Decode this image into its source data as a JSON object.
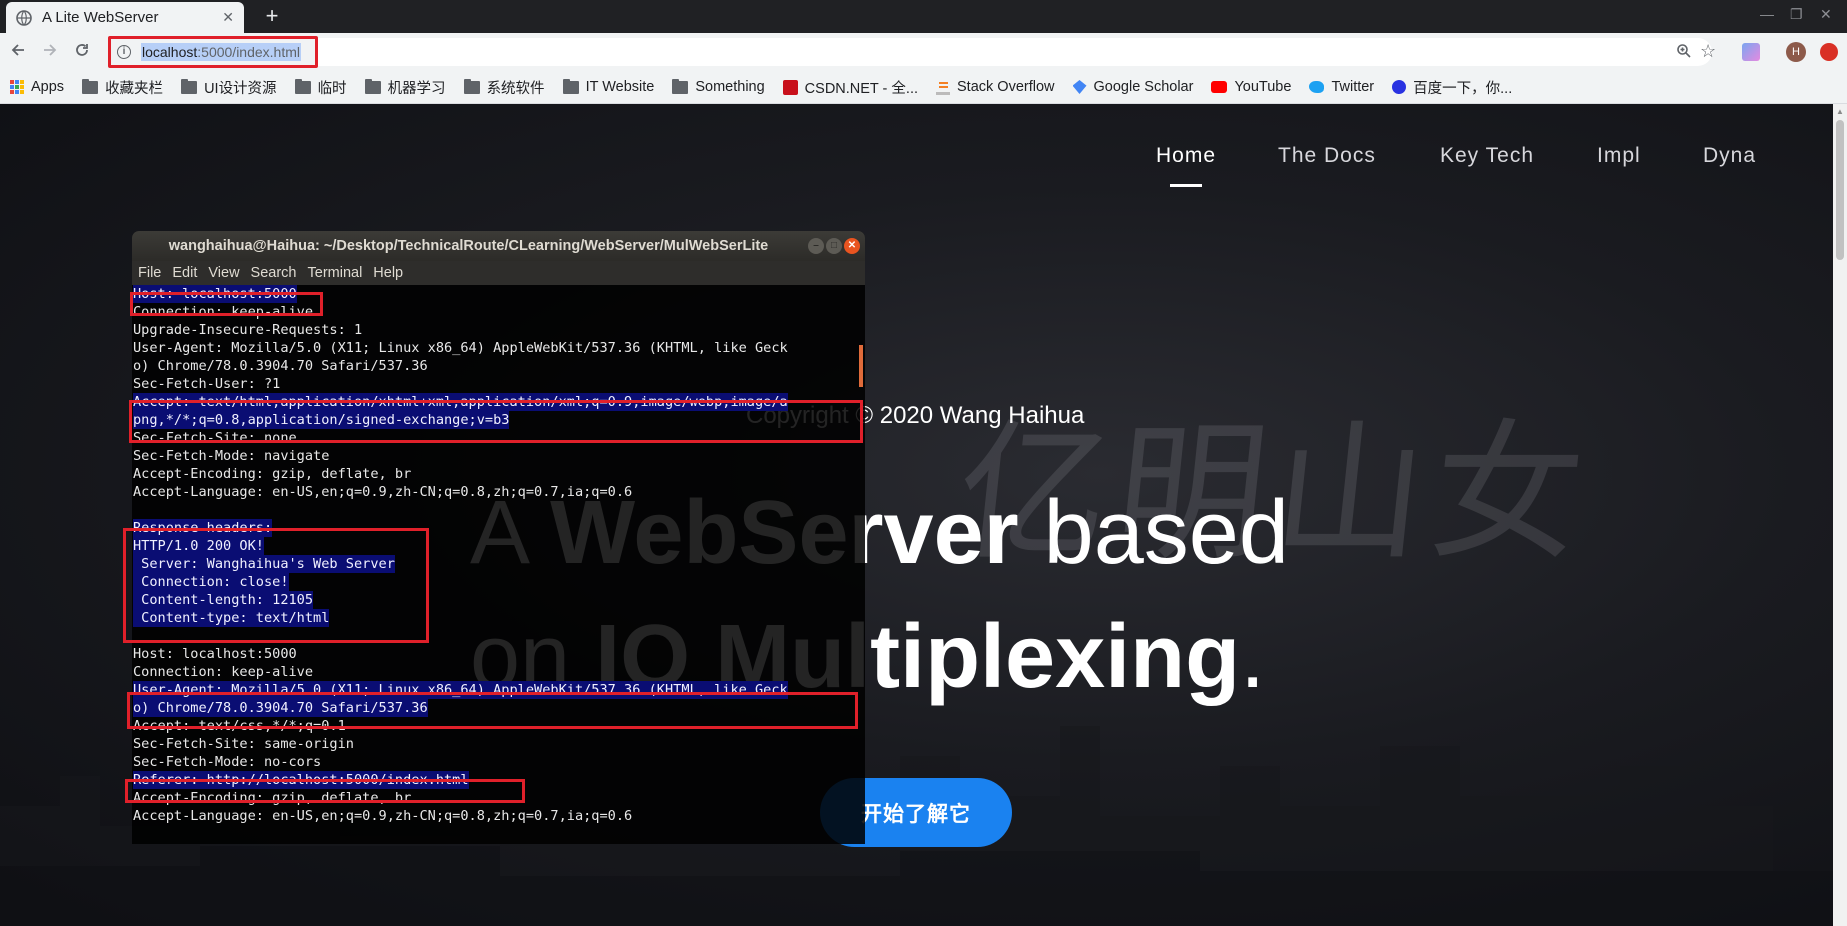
{
  "browser": {
    "tab_title": "A Lite WebServer",
    "tab_close": "✕",
    "new_tab": "+",
    "url_host": "localhost",
    "url_rest": ":5000/index.html",
    "bookmarks": [
      {
        "label": "Apps",
        "icon": "apps-grid-icon"
      },
      {
        "label": "收藏夹栏",
        "icon": "folder-icon"
      },
      {
        "label": "UI设计资源",
        "icon": "folder-icon"
      },
      {
        "label": "临时",
        "icon": "folder-icon"
      },
      {
        "label": "机器学习",
        "icon": "folder-icon"
      },
      {
        "label": "系统软件",
        "icon": "folder-icon"
      },
      {
        "label": "IT Website",
        "icon": "folder-icon"
      },
      {
        "label": "Something",
        "icon": "folder-icon"
      },
      {
        "label": "CSDN.NET - 全...",
        "icon": "csdn-icon"
      },
      {
        "label": "Stack Overflow",
        "icon": "stackoverflow-icon"
      },
      {
        "label": "Google Scholar",
        "icon": "scholar-icon"
      },
      {
        "label": "YouTube",
        "icon": "youtube-icon"
      },
      {
        "label": "Twitter",
        "icon": "twitter-icon"
      },
      {
        "label": "百度一下，你...",
        "icon": "baidu-icon"
      }
    ],
    "profile_initial": "H"
  },
  "site": {
    "nav": [
      "Home",
      "The Docs",
      "Key Tech",
      "Impl",
      "Dyna"
    ],
    "copyright": "Copyright © 2020 Wang Haihua",
    "headline_1a": "A ",
    "headline_1b": "WebServer",
    "headline_1c": " based",
    "headline_2a": "on ",
    "headline_2b": "IO Multiplexing",
    "headline_2c": ".",
    "cta": "开始了解它",
    "colors": {
      "accent": "#1a82f0"
    }
  },
  "terminal": {
    "title": "wanghaihua@Haihua: ~/Desktop/TechnicalRoute/CLearning/WebServer/MulWebSerLite",
    "menu": [
      "File",
      "Edit",
      "View",
      "Search",
      "Terminal",
      "Help"
    ],
    "lines": [
      {
        "text": "Host: localhost:5000",
        "hl": true
      },
      {
        "text": "Connection: keep-alive",
        "hl": false
      },
      {
        "text": "Upgrade-Insecure-Requests: 1",
        "hl": false
      },
      {
        "text": "User-Agent: Mozilla/5.0 (X11; Linux x86_64) AppleWebKit/537.36 (KHTML, like Geck",
        "hl": false
      },
      {
        "text": "o) Chrome/78.0.3904.70 Safari/537.36",
        "hl": false
      },
      {
        "text": "Sec-Fetch-User: ?1",
        "hl": false
      },
      {
        "text": "Accept: text/html,application/xhtml+xml,application/xml;q=0.9,image/webp,image/a",
        "hl": true
      },
      {
        "text": "png,*/*;q=0.8,application/signed-exchange;v=b3",
        "hl": true
      },
      {
        "text": "Sec-Fetch-Site: none",
        "hl": false
      },
      {
        "text": "Sec-Fetch-Mode: navigate",
        "hl": false
      },
      {
        "text": "Accept-Encoding: gzip, deflate, br",
        "hl": false
      },
      {
        "text": "Accept-Language: en-US,en;q=0.9,zh-CN;q=0.8,zh;q=0.7,ia;q=0.6",
        "hl": false
      },
      {
        "text": "",
        "hl": false
      },
      {
        "text": "Response headers:",
        "hl": true
      },
      {
        "text": "HTTP/1.0 200 OK!",
        "hl": true
      },
      {
        "text": " Server: Wanghaihua's Web Server",
        "hl": true
      },
      {
        "text": " Connection: close!",
        "hl": true
      },
      {
        "text": " Content-length: 12105",
        "hl": true
      },
      {
        "text": " Content-type: text/html",
        "hl": true
      },
      {
        "text": "",
        "hl": false
      },
      {
        "text": "Host: localhost:5000",
        "hl": false
      },
      {
        "text": "Connection: keep-alive",
        "hl": false
      },
      {
        "text": "User-Agent: Mozilla/5.0 (X11; Linux x86_64) AppleWebKit/537.36 (KHTML, like Geck",
        "hl": true
      },
      {
        "text": "o) Chrome/78.0.3904.70 Safari/537.36",
        "hl": true
      },
      {
        "text": "Accept: text/css,*/*;q=0.1",
        "hl": false
      },
      {
        "text": "Sec-Fetch-Site: same-origin",
        "hl": false
      },
      {
        "text": "Sec-Fetch-Mode: no-cors",
        "hl": false
      },
      {
        "text": "Referer: http://localhost:5000/index.html",
        "hl": true
      },
      {
        "text": "Accept-Encoding: gzip, deflate, br",
        "hl": false
      },
      {
        "text": "Accept-Language: en-US,en;q=0.9,zh-CN;q=0.8,zh;q=0.7,ia;q=0.6",
        "hl": false
      }
    ]
  }
}
